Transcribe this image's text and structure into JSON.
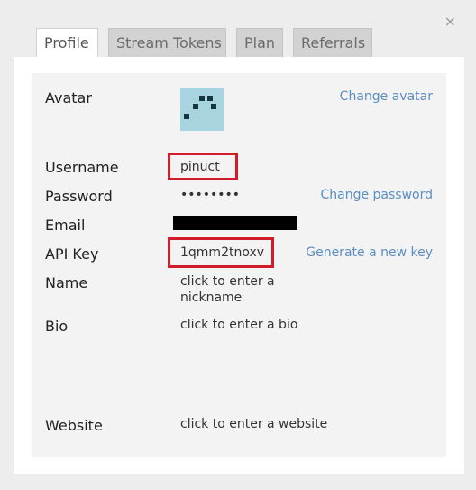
{
  "dialog": {
    "close_label": "×"
  },
  "tabs": [
    {
      "label": "Profile",
      "active": true
    },
    {
      "label": "Stream Tokens",
      "active": false
    },
    {
      "label": "Plan",
      "active": false
    },
    {
      "label": "Referrals",
      "active": false
    }
  ],
  "profile": {
    "avatar_label": "Avatar",
    "change_avatar": "Change avatar",
    "username_label": "Username",
    "username_value": "pinuct",
    "password_label": "Password",
    "password_value": "••••••••",
    "change_password": "Change password",
    "email_label": "Email",
    "api_key_label": "API Key",
    "api_key_value": "1qmm2tnoxv",
    "generate_key": "Generate a new key",
    "name_label": "Name",
    "name_value": "click to enter a nickname",
    "bio_label": "Bio",
    "bio_value": "click to enter a bio",
    "website_label": "Website",
    "website_value": "click to enter a website"
  },
  "colors": {
    "link": "#5b8ec2",
    "highlight": "#d21b2b",
    "avatar_bg": "#a8d4e0"
  },
  "icons": {
    "close": "close-icon"
  }
}
